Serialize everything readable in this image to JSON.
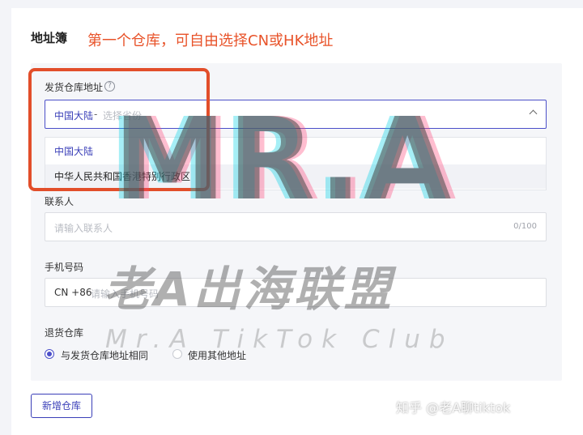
{
  "page": {
    "title": "地址簿",
    "annotation": "第一个仓库，可自由选择CN或HK地址"
  },
  "ship_warehouse": {
    "label": "发货仓库地址",
    "help_icon": "?",
    "selected_region": "中国大陆",
    "separator": "-",
    "province_placeholder": "选择省份",
    "options": [
      "中国大陆",
      "中华人民共和国香港特别行政区"
    ]
  },
  "contact": {
    "label": "联系人",
    "placeholder": "请输入联系人",
    "counter": "0/100"
  },
  "phone": {
    "label": "手机号码",
    "prefix": "CN +86",
    "placeholder": "请输入手机号码"
  },
  "return_warehouse": {
    "label": "退货仓库",
    "options": [
      {
        "label": "与发货仓库地址相同",
        "selected": true
      },
      {
        "label": "使用其他地址",
        "selected": false
      }
    ]
  },
  "actions": {
    "add_warehouse": "新增仓库"
  },
  "watermark": {
    "big": "MR.A",
    "cn": "老A出海联盟",
    "en": "Mr.A TikTok Club",
    "source": "知乎 @老A聊tiktok"
  },
  "colors": {
    "accent": "#4b4fc9",
    "annotation": "#e8532a",
    "highlight_box": "#e24e2a"
  }
}
